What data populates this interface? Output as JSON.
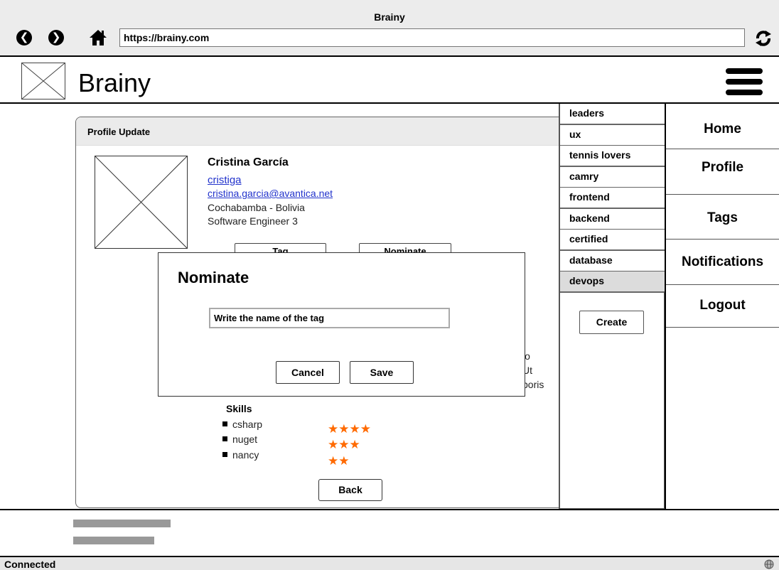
{
  "browser": {
    "title": "Brainy",
    "url": "https://brainy.com",
    "status": "Connected"
  },
  "app": {
    "name": "Brainy"
  },
  "profile_panel": {
    "title": "Profile Update",
    "name": "Cristina García",
    "username": "cristiga",
    "email": "cristina.garcia@avantica.net ",
    "location": "Cochabamba - Bolivia",
    "role": "Software Engineer 3",
    "tag_button": "Tag",
    "nominate_button": "Nominate",
    "bio_fragments": [
      "lo",
      "Ut",
      "boris"
    ],
    "skills_title": "Skills",
    "skills": [
      {
        "name": "csharp",
        "stars": 4,
        "stars_text": "★★★★"
      },
      {
        "name": "nuget",
        "stars": 3,
        "stars_text": "★★★"
      },
      {
        "name": "nancy",
        "stars": 2,
        "stars_text": "★★"
      }
    ],
    "back_button": "Back"
  },
  "tags": {
    "items": [
      "leaders",
      "ux",
      "tennis lovers",
      "camry",
      "frontend",
      "backend",
      "certified",
      "database",
      "devops"
    ],
    "selected": "devops",
    "create_button": "Create"
  },
  "nav": {
    "items": [
      "Home",
      "Profile",
      "Tags",
      "Notifications",
      "Logout"
    ]
  },
  "modal": {
    "title": "Nominate",
    "input_value": "Write the name of the tag",
    "cancel_button": "Cancel",
    "save_button": "Save"
  },
  "colors": {
    "link": "#2233cc",
    "stars": "#ff6a00",
    "selected_tag_bg": "#dcdcdc"
  }
}
